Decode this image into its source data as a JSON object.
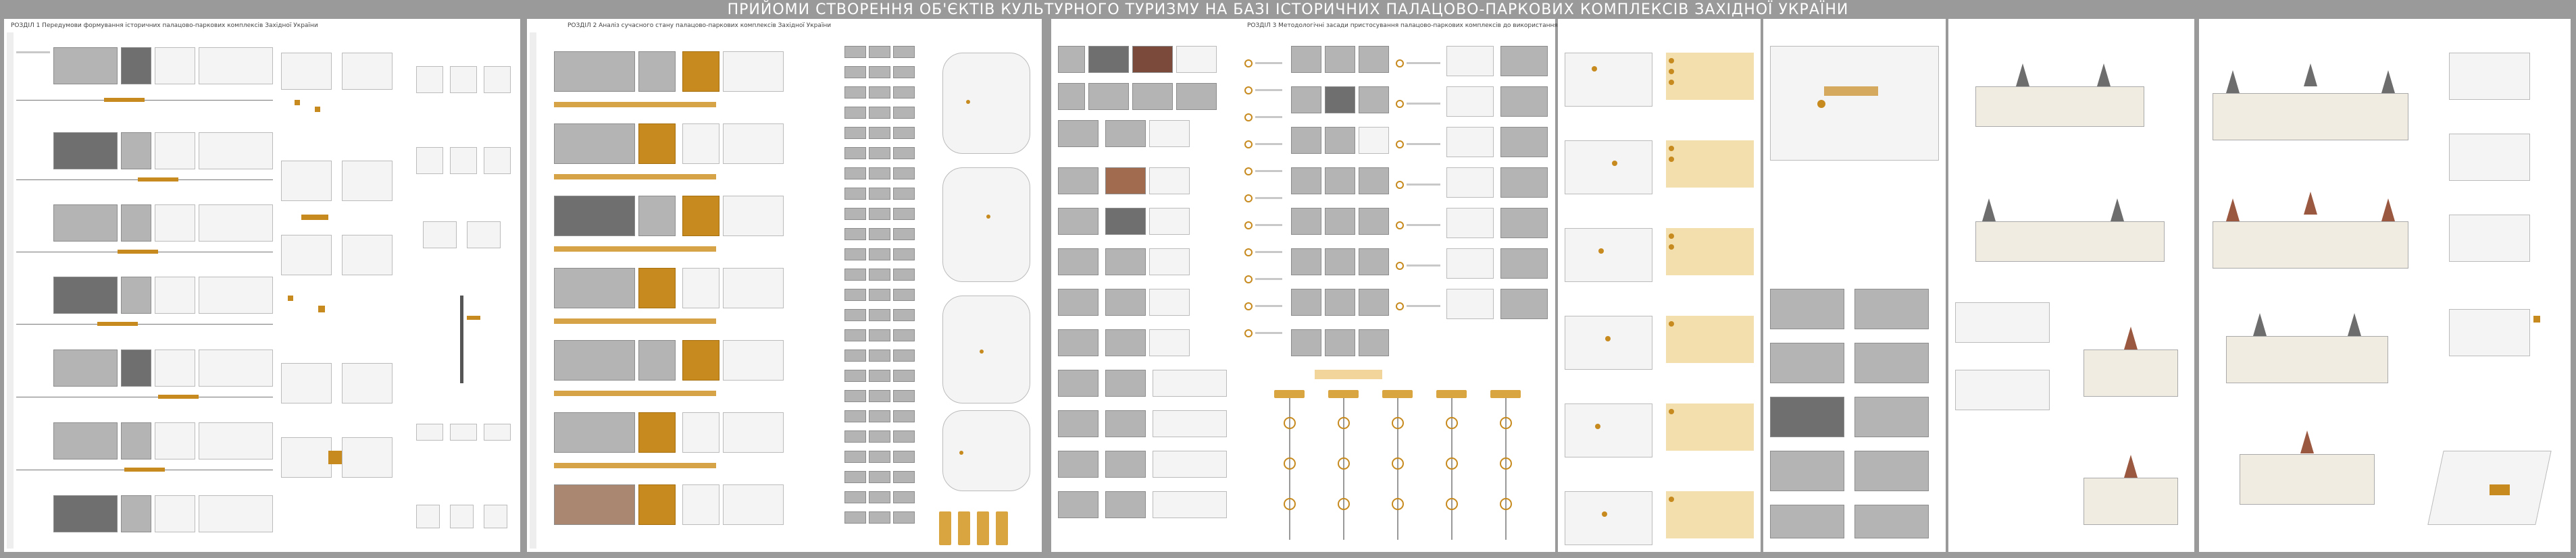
{
  "title": "ПРИЙОМИ СТВОРЕННЯ ОБ'ЄКТІВ КУЛЬТУРНОГО ТУРИЗМУ НА БАЗІ ІСТОРИЧНИХ ПАЛАЦОВО-ПАРКОВИХ КОМПЛЕКСІВ ЗАХІДНОЇ УКРАЇНИ",
  "sections": {
    "s1": "РОЗДІЛ 1 Передумови формування історичних палацово-паркових комплексів Західної України",
    "s2": "РОЗДІЛ 2 Аналіз сучасного стану палацово-паркових комплексів Західної України",
    "s3": "РОЗДІЛ 3 Методологічні засади пристосування палацово-паркових комплексів до використання у сфері культурного туризму"
  },
  "colors": {
    "accent": "#c78a1e",
    "background": "#9a9a9a",
    "board": "#ffffff"
  }
}
